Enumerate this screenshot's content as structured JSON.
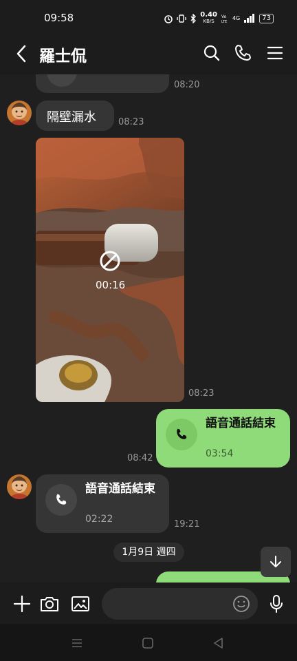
{
  "status_bar": {
    "time": "09:58",
    "net_speed": "0.40",
    "net_unit": "KB/S",
    "network": "4G",
    "battery": "73"
  },
  "header": {
    "contact_name": "羅士侃",
    "icons": [
      "back-icon",
      "search-icon",
      "phone-icon",
      "menu-icon"
    ]
  },
  "messages": {
    "m0": {
      "time": "08:20"
    },
    "m1": {
      "text": "隔壁漏水",
      "time": "08:23"
    },
    "m2": {
      "duration": "00:16",
      "time": "08:23"
    },
    "m3": {
      "title": "語音通話結束",
      "duration": "03:54",
      "time": "08:42"
    },
    "m4": {
      "title": "語音通話結束",
      "duration": "02:22",
      "time": "19:21"
    }
  },
  "date_separator": "1月9日 週四",
  "input": {
    "placeholder": ""
  },
  "colors": {
    "outgoing": "#8fdb7a",
    "incoming": "#353535",
    "background": "#1f1f1f"
  }
}
